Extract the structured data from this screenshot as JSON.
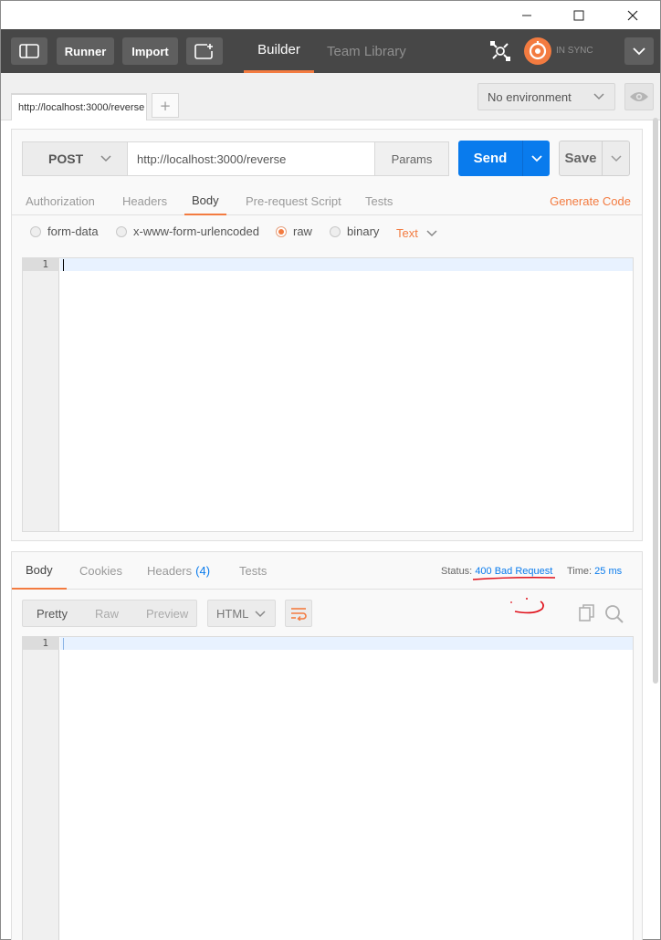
{
  "window": {
    "minimize_glyph": "—",
    "maximize_glyph": "☐",
    "close_glyph": "✕"
  },
  "appbar": {
    "runner_label": "Runner",
    "import_label": "Import",
    "tabs": [
      {
        "label": "Builder",
        "active": true
      },
      {
        "label": "Team Library",
        "active": false
      }
    ],
    "sync_status": "IN SYNC",
    "accent_color": "#f37b40"
  },
  "tabstrip": {
    "request_tab_label": "http://localhost:3000/reverse",
    "add_tab_glyph": "+",
    "environment": "No environment"
  },
  "request": {
    "method": "POST",
    "url": "http://localhost:3000/reverse",
    "params_label": "Params",
    "send_label": "Send",
    "save_label": "Save",
    "tabs": [
      "Authorization",
      "Headers",
      "Body",
      "Pre-request Script",
      "Tests"
    ],
    "active_tab": "Body",
    "generate_code_label": "Generate Code",
    "body_modes": [
      "form-data",
      "x-www-form-urlencoded",
      "raw",
      "binary"
    ],
    "selected_mode": "raw",
    "raw_type": "Text",
    "editor_line": "1"
  },
  "response": {
    "tabs": [
      {
        "label": "Body"
      },
      {
        "label": "Cookies"
      },
      {
        "label": "Headers",
        "count": "(4)"
      },
      {
        "label": "Tests"
      }
    ],
    "active_tab": "Body",
    "status_label": "Status:",
    "status_value": "400 Bad Request",
    "time_label": "Time:",
    "time_value": "25 ms",
    "view_modes": [
      "Pretty",
      "Raw",
      "Preview"
    ],
    "active_view": "Pretty",
    "language": "HTML",
    "editor_line": "1"
  },
  "colors": {
    "primary_blue": "#097bed",
    "dark_bar": "#474747",
    "annotation_red": "#e0101a"
  }
}
